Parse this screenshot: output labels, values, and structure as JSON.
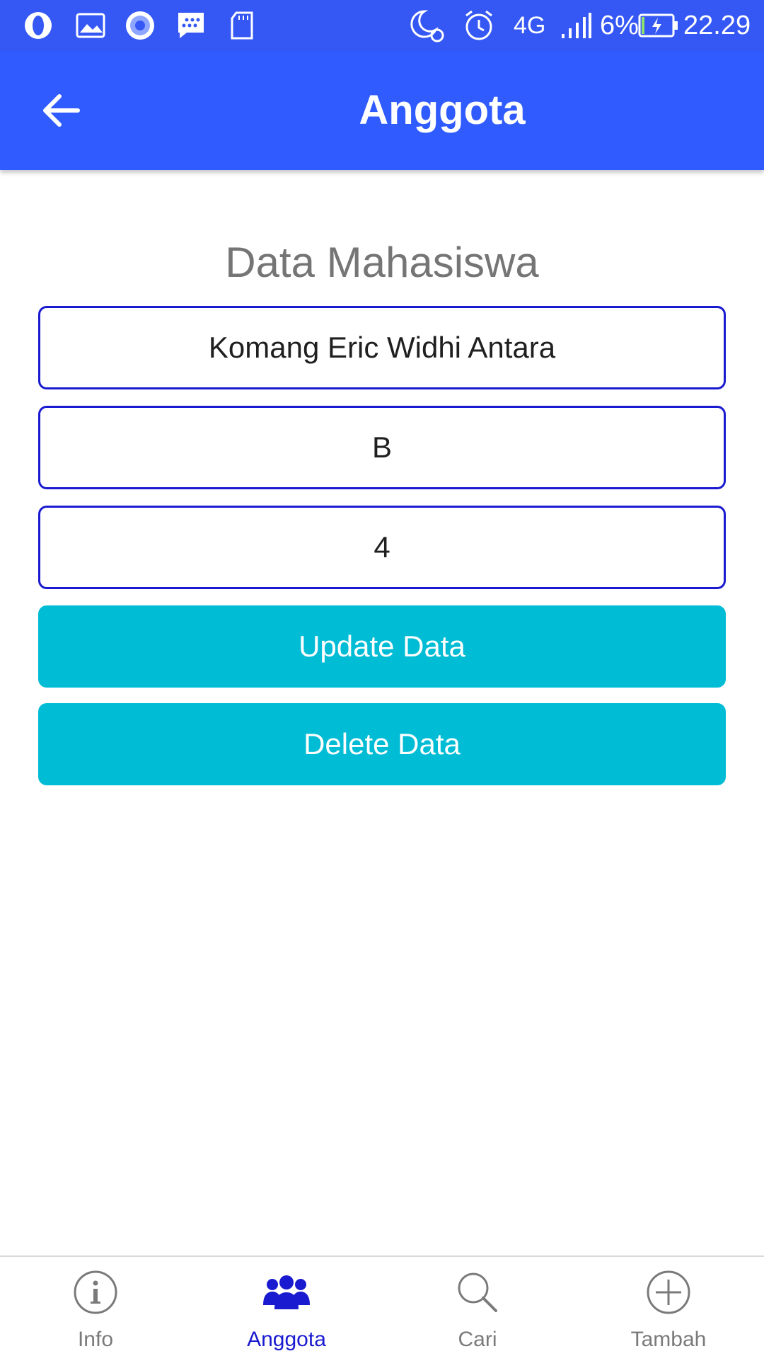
{
  "status_bar": {
    "network": "4G",
    "battery": "6%",
    "time": "22.29"
  },
  "app_bar": {
    "title": "Anggota"
  },
  "form": {
    "heading": "Data Mahasiswa",
    "name_value": "Komang Eric Widhi Antara",
    "class_value": "B",
    "semester_value": "4",
    "update_label": "Update Data",
    "delete_label": "Delete Data"
  },
  "bottom_nav": {
    "items": [
      {
        "label": "Info",
        "icon": "info-icon"
      },
      {
        "label": "Anggota",
        "icon": "group-icon",
        "active": true
      },
      {
        "label": "Cari",
        "icon": "search-icon"
      },
      {
        "label": "Tambah",
        "icon": "add-icon"
      }
    ]
  },
  "colors": {
    "status_bar": "#3558f5",
    "app_bar": "#305cff",
    "field_border": "#1a1ad0",
    "button": "#00bcd4",
    "active_nav": "#1a1ad0"
  }
}
